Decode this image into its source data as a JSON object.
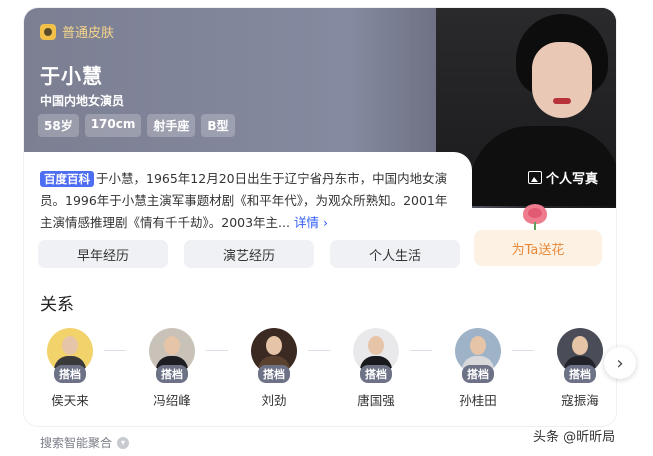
{
  "header": {
    "skin_label": "普通皮肤",
    "name": "于小慧",
    "subtitle": "中国内地女演员",
    "tags": [
      "58岁",
      "170cm",
      "射手座",
      "B型"
    ],
    "photo_button": "个人写真"
  },
  "intro": {
    "badge": "百度百科",
    "text": "于小慧，1965年12月20日出生于辽宁省丹东市，中国内地女演员。1996年于小慧主演军事题材剧《和平年代》，为观众所熟知。2001年主演情感推理剧《情有千千劫》。2003年主...",
    "more_link": "详情"
  },
  "tabs": [
    "早年经历",
    "演艺经历",
    "个人生活"
  ],
  "gift_button": "为Ta送花",
  "relations": {
    "title": "关系",
    "people": [
      {
        "name": "侯天来",
        "badge": "搭档"
      },
      {
        "name": "冯绍峰",
        "badge": "搭档"
      },
      {
        "name": "刘劲",
        "badge": "搭档"
      },
      {
        "name": "唐国强",
        "badge": "搭档"
      },
      {
        "name": "孙桂田",
        "badge": "搭档"
      },
      {
        "name": "寇振海",
        "badge": "搭档"
      }
    ]
  },
  "footer": {
    "text": "搜索智能聚合"
  },
  "watermark": "头条 @昕昕局",
  "colors": {
    "accent": "#4e6ef2",
    "gift_text": "#e8893a",
    "badge_bg": "#6d7287"
  }
}
